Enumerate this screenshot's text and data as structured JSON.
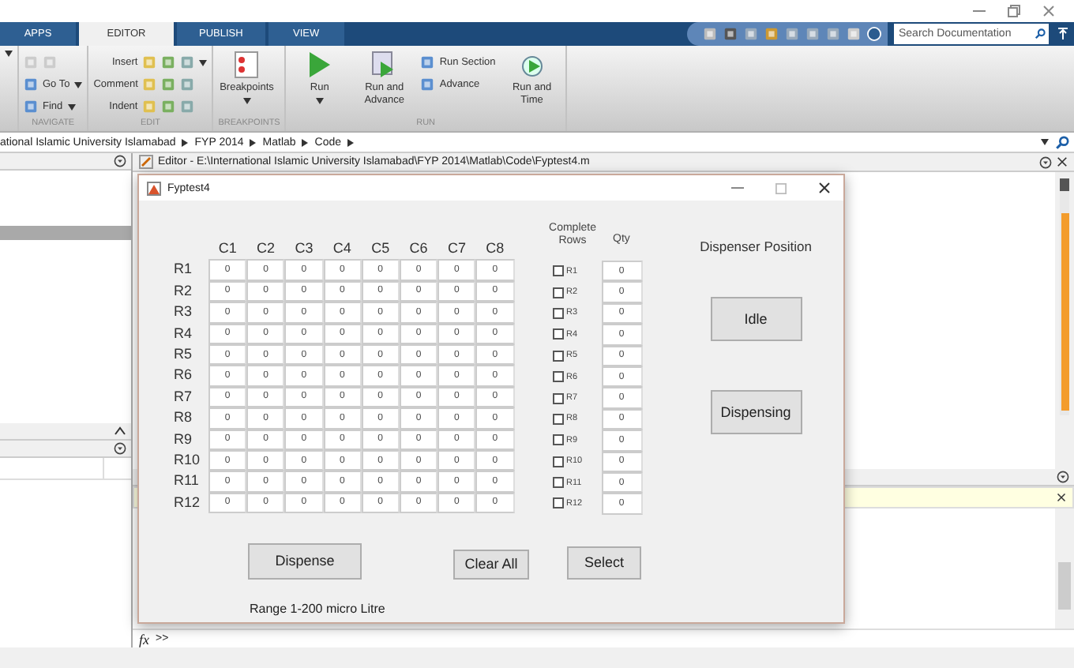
{
  "ribbon": {
    "tabs": [
      {
        "label": "APPS",
        "selected": false
      },
      {
        "label": "EDITOR",
        "selected": true
      },
      {
        "label": "PUBLISH",
        "selected": false
      },
      {
        "label": "VIEW",
        "selected": false
      }
    ],
    "search": {
      "placeholder": "Search Documentation"
    },
    "groups": [
      {
        "label": "NAVIGATE",
        "items": [
          {
            "kind": "links",
            "rows": [
              {},
              {
                "label": "Go To",
                "caret": true
              },
              {
                "label": "Find",
                "caret": true
              }
            ]
          }
        ]
      },
      {
        "label": "EDIT",
        "items": [
          {
            "kind": "tools",
            "rows": [
              {
                "label": "Insert",
                "caret": true
              },
              {
                "label": "Comment",
                "caret": false
              },
              {
                "label": "Indent",
                "caret": false
              }
            ]
          }
        ]
      },
      {
        "label": "BREAKPOINTS",
        "items": [
          {
            "kind": "breakpoint",
            "label": "Breakpoints",
            "caret": true
          }
        ]
      },
      {
        "label": "RUN",
        "items": [
          {
            "kind": "run",
            "label": "Run",
            "caret": true
          },
          {
            "kind": "advance",
            "label": "Run and Advance",
            "caret": false
          },
          {
            "kind": "links",
            "rows": [
              {
                "label": "Run Section",
                "caret": false
              },
              {
                "label": "Advance",
                "caret": false
              }
            ]
          },
          {
            "kind": "timer",
            "label": "Run and Time",
            "caret": false
          }
        ]
      }
    ]
  },
  "path": [
    "ational Islamic University Islamabad",
    "FYP 2014",
    "Matlab",
    "Code"
  ],
  "editor": {
    "title": "Editor - E:\\International Islamic University Islamabad\\FYP 2014\\Matlab\\Code\\Fyptest4.m"
  },
  "command_window": {
    "function_button": "fx",
    "prompt": ">>"
  },
  "dialog": {
    "title": "Fyptest4",
    "columns": [
      "C1",
      "C2",
      "C3",
      "C4",
      "C5",
      "C6",
      "C7",
      "C8"
    ],
    "rows": [
      {
        "label": "R1",
        "cells": [
          "0",
          "0",
          "0",
          "0",
          "0",
          "0",
          "0",
          "0"
        ]
      },
      {
        "label": "R2",
        "cells": [
          "0",
          "0",
          "0",
          "0",
          "0",
          "0",
          "0",
          "0"
        ]
      },
      {
        "label": "R3",
        "cells": [
          "0",
          "0",
          "0",
          "0",
          "0",
          "0",
          "0",
          "0"
        ]
      },
      {
        "label": "R4",
        "cells": [
          "0",
          "0",
          "0",
          "0",
          "0",
          "0",
          "0",
          "0"
        ]
      },
      {
        "label": "R5",
        "cells": [
          "0",
          "0",
          "0",
          "0",
          "0",
          "0",
          "0",
          "0"
        ]
      },
      {
        "label": "R6",
        "cells": [
          "0",
          "0",
          "0",
          "0",
          "0",
          "0",
          "0",
          "0"
        ]
      },
      {
        "label": "R7",
        "cells": [
          "0",
          "0",
          "0",
          "0",
          "0",
          "0",
          "0",
          "0"
        ]
      },
      {
        "label": "R8",
        "cells": [
          "0",
          "0",
          "0",
          "0",
          "0",
          "0",
          "0",
          "0"
        ]
      },
      {
        "label": "R9",
        "cells": [
          "0",
          "0",
          "0",
          "0",
          "0",
          "0",
          "0",
          "0"
        ]
      },
      {
        "label": "R10",
        "cells": [
          "0",
          "0",
          "0",
          "0",
          "0",
          "0",
          "0",
          "0"
        ]
      },
      {
        "label": "R11",
        "cells": [
          "0",
          "0",
          "0",
          "0",
          "0",
          "0",
          "0",
          "0"
        ]
      },
      {
        "label": "R12",
        "cells": [
          "0",
          "0",
          "0",
          "0",
          "0",
          "0",
          "0",
          "0"
        ]
      }
    ],
    "complete_rows": {
      "title": "Complete Rows",
      "items": [
        {
          "label": "R1",
          "checked": false
        },
        {
          "label": "R2",
          "checked": false
        },
        {
          "label": "R3",
          "checked": false
        },
        {
          "label": "R4",
          "checked": false
        },
        {
          "label": "R5",
          "checked": false
        },
        {
          "label": "R6",
          "checked": false
        },
        {
          "label": "R7",
          "checked": false
        },
        {
          "label": "R8",
          "checked": false
        },
        {
          "label": "R9",
          "checked": false
        },
        {
          "label": "R10",
          "checked": false
        },
        {
          "label": "R11",
          "checked": false
        },
        {
          "label": "R12",
          "checked": false
        }
      ]
    },
    "qty": {
      "title": "Qty",
      "values": [
        "0",
        "0",
        "0",
        "0",
        "0",
        "0",
        "0",
        "0",
        "0",
        "0",
        "0",
        "0"
      ]
    },
    "position": {
      "title": "Dispenser Position",
      "buttons": [
        "Idle",
        "Dispensing"
      ]
    },
    "dispense_button": "Dispense",
    "clear_button": "Clear All",
    "select_button": "Select",
    "range_note": "Range 1-200 micro Litre"
  }
}
